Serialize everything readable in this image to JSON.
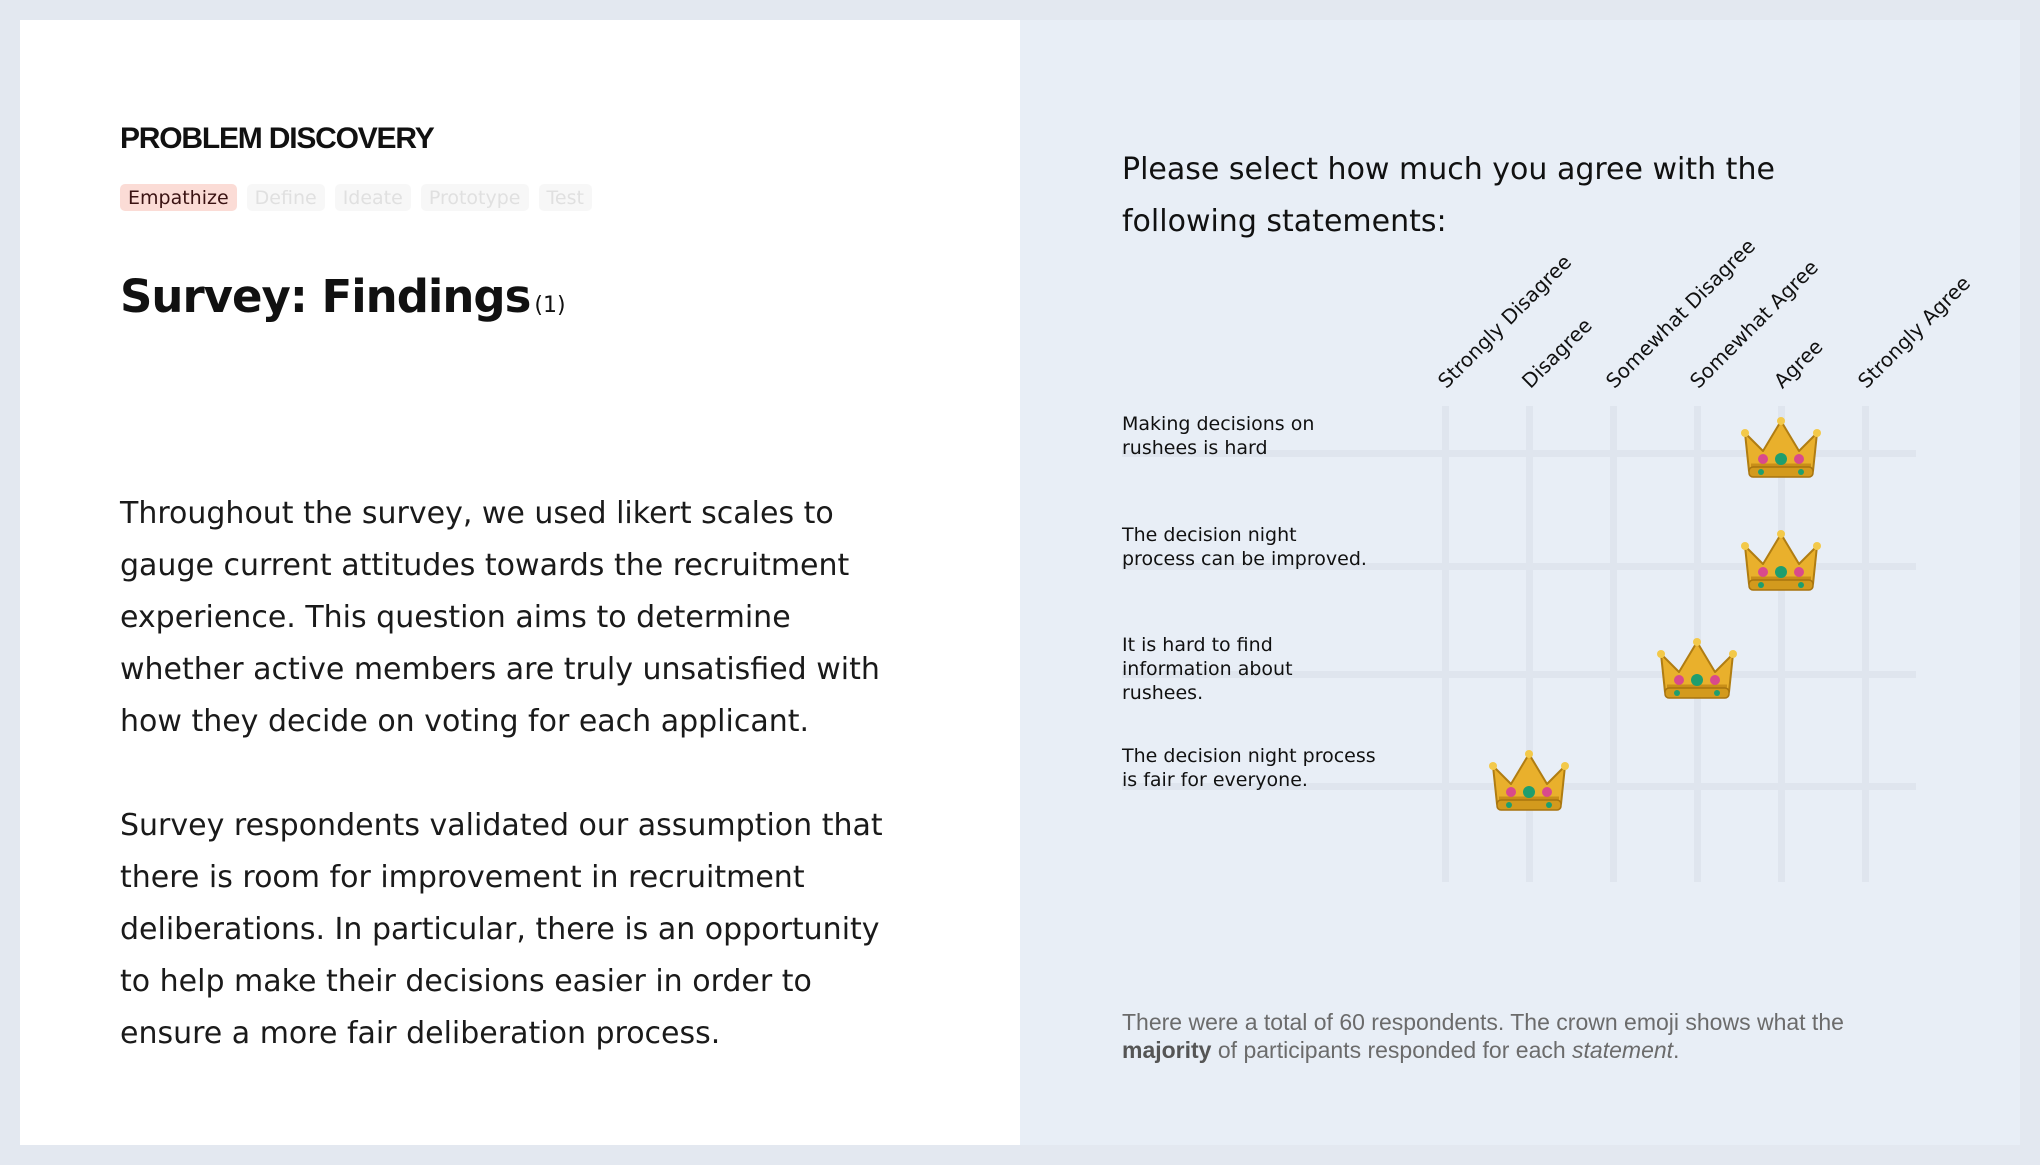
{
  "left": {
    "eyebrow": "PROBLEM DISCOVERY",
    "stages": [
      "Empathize",
      "Define",
      "Ideate",
      "Prototype",
      "Test"
    ],
    "active_stage": "Empathize",
    "title": "Survey: Findings",
    "title_note": "(1)",
    "paragraphs": [
      "Throughout the survey, we used likert scales to gauge current attitudes towards the recruitment experience. This question aims to determine whether active members are truly unsatisfied with how they decide on voting for each applicant.",
      "Survey respondents validated our assumption that there is room for improvement in recruitment deliberations. In particular, there is an opportunity to help make their decisions easier in order to ensure a more fair deliberation process."
    ]
  },
  "right": {
    "question": "Please select how much you agree with the following statements:",
    "scale": [
      "Strongly Disagree",
      "Disagree",
      "Somewhat Disagree",
      "Somewhat Agree",
      "Agree",
      "Strongly Agree"
    ],
    "statements": [
      {
        "text": "Making decisions on rushees is hard",
        "majority": "Agree"
      },
      {
        "text": "The decision night process can be improved.",
        "majority": "Agree"
      },
      {
        "text": "It is hard to find information about rushees.",
        "majority": "Somewhat Agree"
      },
      {
        "text": "The decision night process is fair for everyone.",
        "majority": "Disagree"
      }
    ],
    "marker_icon": "crown-emoji",
    "note": {
      "part1": "There were a total of 60 respondents. The crown emoji shows what the ",
      "bold": "majority",
      "part2": " of participants responded for each ",
      "italic": "statement",
      "part3": "."
    }
  },
  "colors": {
    "active_chip_bg": "#fbdcd6",
    "panel_bg": "#e8eef6",
    "grid": "#dfe5ee",
    "crown_gold": "#e9b02c"
  }
}
